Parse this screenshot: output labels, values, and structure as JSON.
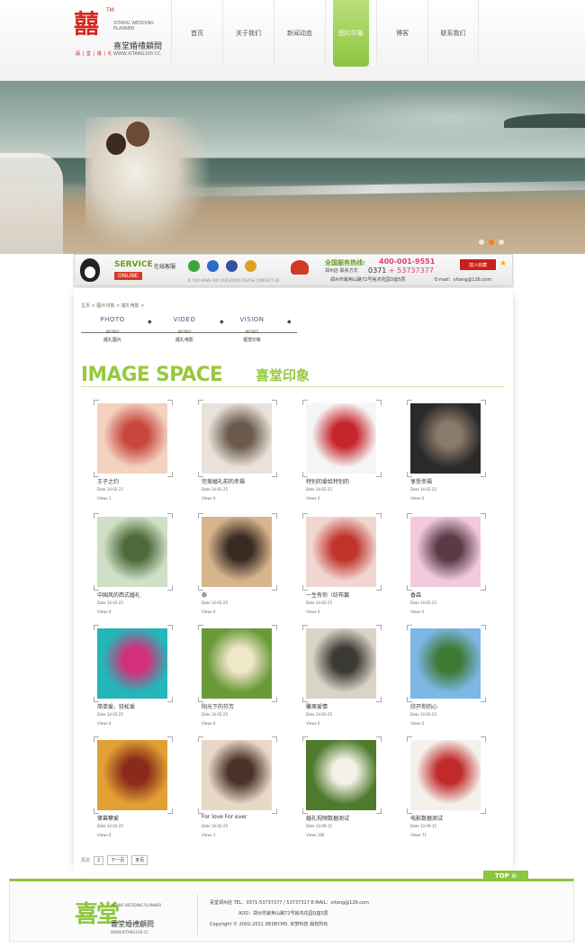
{
  "brand": {
    "logo_char": "囍",
    "tm": "TM",
    "tagline": "囍 | 堂 | 婚 | 礼",
    "en": "XITANG WEDDING PLANNER",
    "cn": "喜堂婚禮顧問",
    "url": "WWW.XITANG100.CC"
  },
  "nav": {
    "items": [
      "首页",
      "关于我们",
      "新闻动态",
      "图片印象",
      "博客",
      "联系我们"
    ],
    "active_index": 3
  },
  "banner": {
    "active_dot": 1,
    "dot_count": 3
  },
  "service": {
    "en": "SERVICE",
    "cn": "在线客服",
    "online": "ONLINE",
    "note": "IF YOU HAVE ANY QUESTION, PLEASE CONTACT US",
    "hotline_label": "全国服务热线:",
    "hotline": "400-001-9551",
    "store_label": "郑州店 联系方式",
    "store_num_a": "0371",
    "store_num_b": "+ 53737377",
    "address": "郑州市紫荆山路72号裕鸿花园D座5层",
    "email": "E-mail：xitang@126.com",
    "fav_btn": "加入收藏",
    "icon_colors": [
      "#3aa53a",
      "#2a6cc7",
      "#3450a0",
      "#e0a020"
    ]
  },
  "breadcrumb": "主页 > 图片印象 > 婚礼电影 >",
  "subnav": [
    {
      "en": "PHOTO",
      "mid": "WORKS",
      "cn": "婚礼图片"
    },
    {
      "en": "VIDEO",
      "mid": "WORKS",
      "cn": "婚礼电影"
    },
    {
      "en": "VISION",
      "mid": "WORKS",
      "cn": "视觉印象"
    }
  ],
  "title": {
    "en": "IMAGE SPACE",
    "cn": "喜堂印象"
  },
  "gallery": [
    {
      "caption": "王子之约",
      "date": "Date 14-02-25",
      "views": "Views 1",
      "c1": "#f3d2c0",
      "c2": "#c7473e"
    },
    {
      "caption": "完美婚礼前的幸福",
      "date": "Date 14-02-25",
      "views": "Views 0",
      "c1": "#e8e2da",
      "c2": "#6b5a4c"
    },
    {
      "caption": "特别的爱给特别的",
      "date": "Date 14-02-25",
      "views": "Views 0",
      "c1": "#f5f5f5",
      "c2": "#c6262b"
    },
    {
      "caption": "享受幸福",
      "date": "Date 14-02-25",
      "views": "Views 0",
      "c1": "#2a2a2a",
      "c2": "#8a7a6a"
    },
    {
      "caption": "中国风的西式婚礼",
      "date": "Date 14-02-25",
      "views": "Views 0",
      "c1": "#cfe0c6",
      "c2": "#4c6a3a"
    },
    {
      "caption": "泰",
      "date": "Date 14-02-25",
      "views": "Views 0",
      "c1": "#d8b48c",
      "c2": "#3a2a24"
    },
    {
      "caption": "一生有你（纺布篇",
      "date": "Date 14-02-25",
      "views": "Views 0",
      "c1": "#f0d6d0",
      "c2": "#c0342c"
    },
    {
      "caption": "香森",
      "date": "Date 14-02-25",
      "views": "Views 0",
      "c1": "#f2c9dd",
      "c2": "#5a3a46"
    },
    {
      "caption": "简单爱、轻松爱",
      "date": "Date 14-02-25",
      "views": "Views 0",
      "c1": "#24b6b8",
      "c2": "#d2307a"
    },
    {
      "caption": "阳光下的芬芳",
      "date": "Date 14-02-25",
      "views": "Views 0",
      "c1": "#6a9a3a",
      "c2": "#f0e6c8"
    },
    {
      "caption": "雕琢爱情",
      "date": "Date 14-02-25",
      "views": "Views 0",
      "c1": "#d9d4c6",
      "c2": "#3c3a34"
    },
    {
      "caption": "欣开你的心",
      "date": "Date 14-02-25",
      "views": "Views 0",
      "c1": "#7eb6e6",
      "c2": "#3e7a34"
    },
    {
      "caption": "肇幕攀爱",
      "date": "Date 14-02-25",
      "views": "Views 0",
      "c1": "#e0a034",
      "c2": "#8a2a1a"
    },
    {
      "caption": "For love For ever",
      "date": "Date 14-02-25",
      "views": "Views 1",
      "c1": "#e8d8c8",
      "c2": "#4a3228"
    },
    {
      "caption": "婚礼视频数据测试",
      "date": "Date 13-09-15",
      "views": "Views 186",
      "c1": "#4f7a2e",
      "c2": "#f4f2e6"
    },
    {
      "caption": "电影数据测试",
      "date": "Date 13-09-15",
      "views": "Views 71",
      "c1": "#f4f0ea",
      "c2": "#c02a2a"
    }
  ],
  "pager": {
    "label": "页次",
    "current": "2",
    "next": "下一页",
    "last": "末页"
  },
  "footer": {
    "top": "TOP ⊙",
    "mark": "喜堂",
    "en": "XITANG WEDDING PLANNER",
    "cn": "喜堂婚禮顧問",
    "url": "WWW.XITANG100.CC",
    "line1": "喜堂郑州店 TEL：0371-53737377 / 53737317 E-MAIL：xitang@126.com",
    "line2": "ADD：郑州市紫荆山路72号裕鸿花园D座5层",
    "line3": "Copyright © 2002-2011 DEDECMS. 织梦科技 版权所有"
  }
}
